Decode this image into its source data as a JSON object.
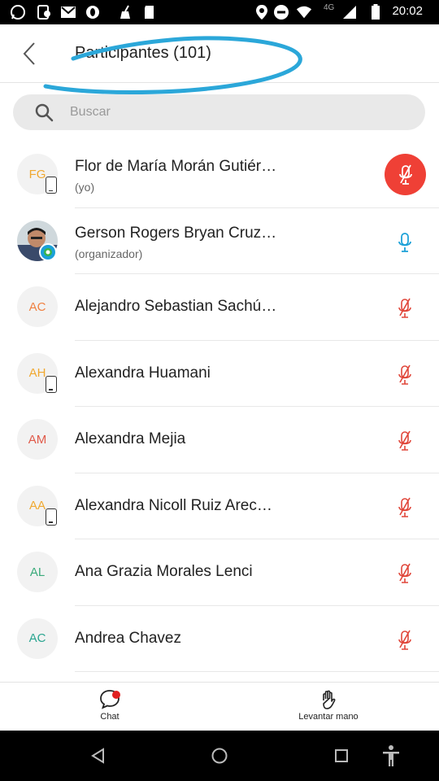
{
  "status_bar": {
    "time": "20:02",
    "network": "4G",
    "left_icons": [
      "whatsapp-icon",
      "message-icon",
      "gmail-icon",
      "opera-icon",
      "cleaner-icon",
      "sd-card-icon"
    ],
    "right_icons": [
      "location-icon",
      "dnd-icon",
      "wifi-icon",
      "signal-icon",
      "battery-icon"
    ]
  },
  "header": {
    "title": "Participantes (101)",
    "back_icon": "chevron-left-icon"
  },
  "search": {
    "placeholder": "Buscar",
    "value": ""
  },
  "participants": [
    {
      "initials": "FG",
      "initials_color": "#f0a830",
      "name": "Flor de María Morán Gutiér…",
      "subtitle": "(yo)",
      "device_badge": true,
      "mic": "muted-active"
    },
    {
      "initials": "",
      "initials_color": "",
      "name": "Gerson Rogers Bryan Cruz…",
      "subtitle": "(organizador)",
      "photo": true,
      "mic": "on"
    },
    {
      "initials": "AC",
      "initials_color": "#f08040",
      "name": "Alejandro Sebastian Sachú…",
      "subtitle": "",
      "device_badge": false,
      "mic": "muted"
    },
    {
      "initials": "AH",
      "initials_color": "#f0a830",
      "name": "Alexandra Huamani",
      "subtitle": "",
      "device_badge": true,
      "mic": "muted"
    },
    {
      "initials": "AM",
      "initials_color": "#e05a4a",
      "name": "Alexandra Mejia",
      "subtitle": "",
      "device_badge": false,
      "mic": "muted"
    },
    {
      "initials": "AA",
      "initials_color": "#f0a830",
      "name": "Alexandra Nicoll Ruiz Arec…",
      "subtitle": "",
      "device_badge": true,
      "mic": "muted"
    },
    {
      "initials": "AL",
      "initials_color": "#3aaa7a",
      "name": "Ana Grazia Morales Lenci",
      "subtitle": "",
      "device_badge": false,
      "mic": "muted"
    },
    {
      "initials": "AC",
      "initials_color": "#2aa590",
      "name": "Andrea Chavez",
      "subtitle": "",
      "device_badge": false,
      "mic": "muted"
    }
  ],
  "toolbar": {
    "chat_label": "Chat",
    "raise_hand_label": "Levantar mano"
  },
  "colors": {
    "muted_mic": "#e0463a",
    "active_mic": "#1da1d8",
    "annotation_scribble": "#2ba7d9"
  }
}
